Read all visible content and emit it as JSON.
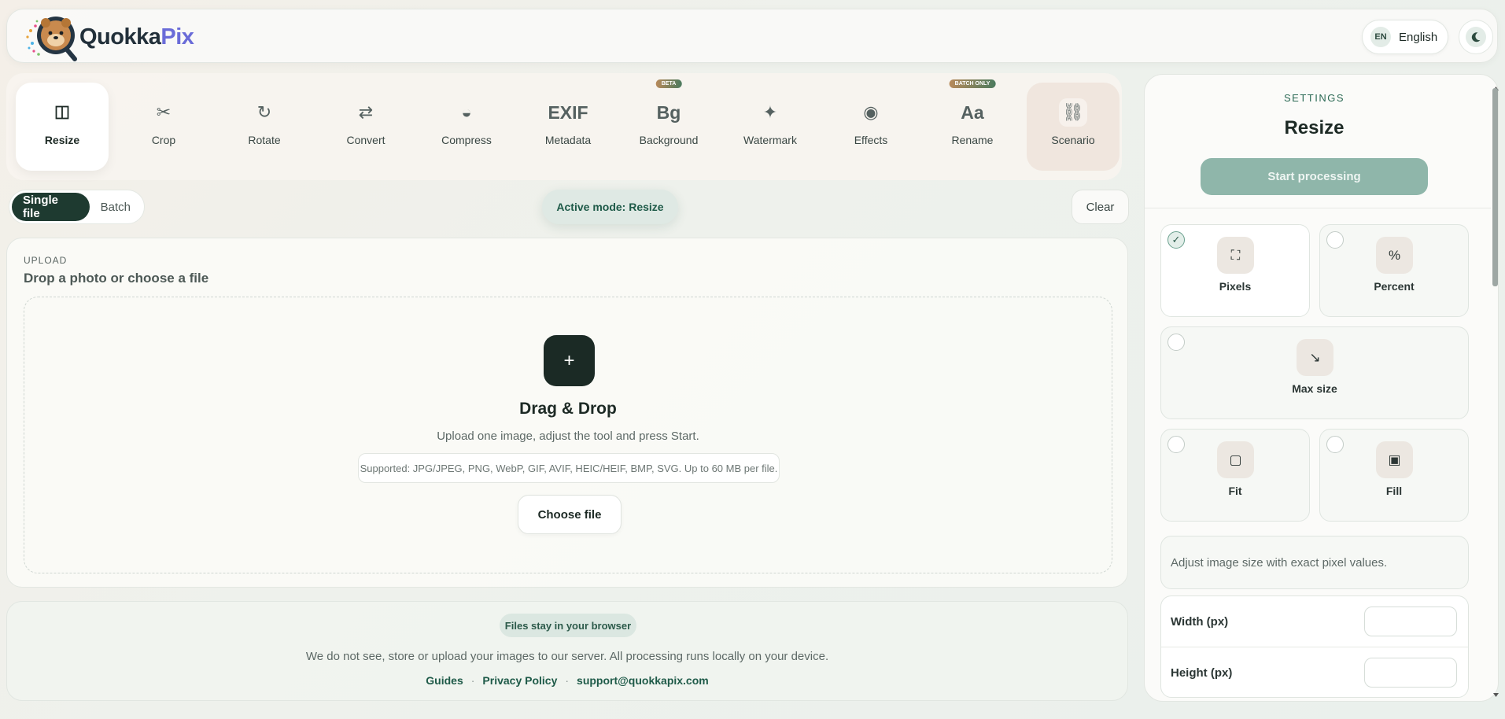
{
  "header": {
    "logo_word_a": "Quokka",
    "logo_word_b": "Pix",
    "lang_code": "EN",
    "lang_name": "English"
  },
  "tools": [
    {
      "label": "Resize",
      "icon": "columns-icon",
      "glyph": "◫",
      "active": true
    },
    {
      "label": "Crop",
      "icon": "scissors-icon",
      "glyph": "✂"
    },
    {
      "label": "Rotate",
      "icon": "rotate-icon",
      "glyph": "↻"
    },
    {
      "label": "Convert",
      "icon": "swap-icon",
      "glyph": "⇄"
    },
    {
      "label": "Compress",
      "icon": "half-circle-icon",
      "glyph": "◒"
    },
    {
      "label": "Metadata",
      "icon": "exif-icon",
      "glyph": "EXIF"
    },
    {
      "label": "Background",
      "icon": "bg-icon",
      "glyph": "Bg",
      "badge": "BETA"
    },
    {
      "label": "Watermark",
      "icon": "sparkle-icon",
      "glyph": "✦"
    },
    {
      "label": "Effects",
      "icon": "target-icon",
      "glyph": "◉"
    },
    {
      "label": "Rename",
      "icon": "text-icon",
      "glyph": "Aa",
      "badge": "BATCH ONLY"
    },
    {
      "label": "Scenario",
      "icon": "link-icon",
      "glyph": "⛓"
    }
  ],
  "mode": {
    "single": "Single file",
    "batch": "Batch",
    "active_label": "Active mode: Resize",
    "clear": "Clear"
  },
  "upload": {
    "eyebrow": "UPLOAD",
    "title": "Drop a photo or choose a file",
    "plus": "+",
    "dz_title": "Drag & Drop",
    "dz_sub": "Upload one image, adjust the tool and press Start.",
    "supported": "Supported: JPG/JPEG, PNG, WebP, GIF, AVIF, HEIC/HEIF, BMP, SVG. Up to 60 MB per file.",
    "choose": "Choose file"
  },
  "footer": {
    "chip": "Files stay in your browser",
    "text": "We do not see, store or upload your images to our server. All processing runs locally on your device.",
    "links": [
      "Guides",
      "Privacy Policy",
      "support@quokkapix.com"
    ],
    "sep": "·"
  },
  "settings": {
    "eyebrow": "SETTINGS",
    "title": "Resize",
    "start": "Start processing",
    "options": [
      {
        "label": "Pixels",
        "glyph": "⛶",
        "selected": true
      },
      {
        "label": "Percent",
        "glyph": "%"
      },
      {
        "label": "Max size",
        "glyph": "↘"
      },
      {
        "label": "Fit",
        "glyph": "▢"
      },
      {
        "label": "Fill",
        "glyph": "▣"
      }
    ],
    "check": "✓",
    "description": "Adjust image size with exact pixel values.",
    "width_label": "Width (px)",
    "height_label": "Height (px)",
    "width_value": "",
    "height_value": ""
  },
  "colors": {
    "accent": "#1e5a48",
    "dark": "#1b2a25",
    "start_button": "#8fb6aa"
  }
}
